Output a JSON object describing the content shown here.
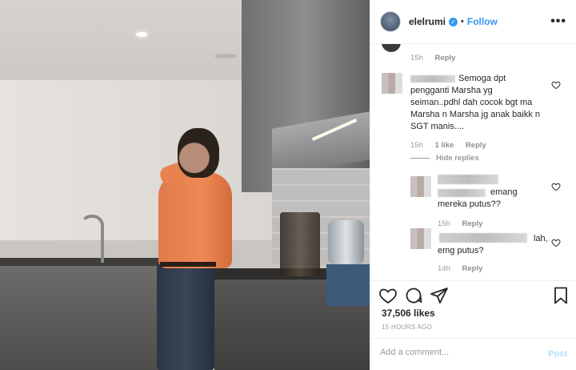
{
  "header": {
    "username": "elelrumi",
    "separator": "•",
    "follow_label": "Follow",
    "more_label": "•••"
  },
  "comments": {
    "top": {
      "time": "15h",
      "reply": "Reply"
    },
    "first": {
      "text_line1": "Semoga dpt",
      "text_line2": "pengganti Marsha yg",
      "text_line3": "seiman..pdhl dah cocok bgt ma",
      "text_line4": "Marsha n Marsha jg anak baikk n",
      "text_line5": "SGT manis....",
      "time": "15h",
      "likes": "1 like",
      "reply": "Reply"
    },
    "hide_replies": "Hide replies",
    "reply1": {
      "text_line1": "emang",
      "text_line2": "mereka putus??",
      "time": "15h",
      "reply": "Reply"
    },
    "reply2": {
      "text_line1": "lah,",
      "text_line2": "emg putus?",
      "time": "14h",
      "reply": "Reply"
    }
  },
  "footer": {
    "likes": "37,506 likes",
    "time_ago": "15 HOURS AGO",
    "comment_placeholder": "Add a comment...",
    "post_label": "Post"
  },
  "colors": {
    "accent": "#3897f0",
    "post_disabled": "#b2dffc"
  },
  "icons": [
    "heart-icon",
    "comment-icon",
    "share-icon",
    "bookmark-icon",
    "verified-icon"
  ]
}
